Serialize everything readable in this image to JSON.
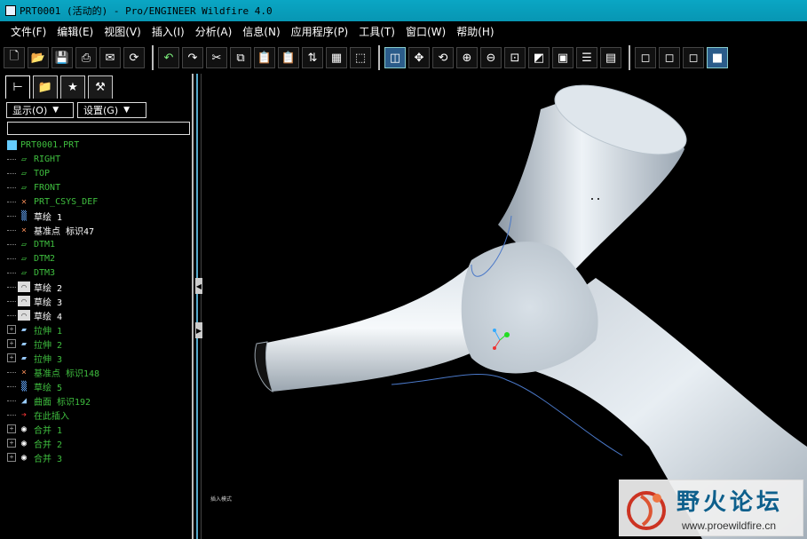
{
  "window": {
    "title": "PRT0001 (活动的) - Pro/ENGINEER Wildfire 4.0"
  },
  "menu": [
    "文件(F)",
    "编辑(E)",
    "视图(V)",
    "插入(I)",
    "分析(A)",
    "信息(N)",
    "应用程序(P)",
    "工具(T)",
    "窗口(W)",
    "帮助(H)"
  ],
  "panel": {
    "show_label": "显示(O)",
    "settings_label": "设置(G)",
    "tree": [
      {
        "label": "PRT0001.PRT",
        "kind": "root"
      },
      {
        "label": "RIGHT",
        "kind": "plane"
      },
      {
        "label": "TOP",
        "kind": "plane"
      },
      {
        "label": "FRONT",
        "kind": "plane"
      },
      {
        "label": "PRT_CSYS_DEF",
        "kind": "csys"
      },
      {
        "label": "草绘 1",
        "kind": "sketch"
      },
      {
        "label": "基准点 标识47",
        "kind": "point"
      },
      {
        "label": "DTM1",
        "kind": "plane"
      },
      {
        "label": "DTM2",
        "kind": "plane"
      },
      {
        "label": "DTM3",
        "kind": "plane"
      },
      {
        "label": "草绘 2",
        "kind": "sketch-white"
      },
      {
        "label": "草绘 3",
        "kind": "sketch-white"
      },
      {
        "label": "草绘 4",
        "kind": "sketch-white"
      },
      {
        "label": "拉伸 1",
        "kind": "extrude"
      },
      {
        "label": "拉伸 2",
        "kind": "extrude"
      },
      {
        "label": "拉伸 3",
        "kind": "extrude"
      },
      {
        "label": "基准点 标识148",
        "kind": "point"
      },
      {
        "label": "草绘 5",
        "kind": "sketch"
      },
      {
        "label": "曲面 标识192",
        "kind": "surface"
      },
      {
        "label": "在此插入",
        "kind": "insert"
      },
      {
        "label": "合并 1",
        "kind": "merge"
      },
      {
        "label": "合并 2",
        "kind": "merge"
      },
      {
        "label": "合并 3",
        "kind": "merge"
      }
    ]
  },
  "graphics": {
    "corner_text": "插入模式"
  },
  "watermark": {
    "title": "野火论坛",
    "url": "www.proewildfire.cn"
  },
  "colors": {
    "tree_text": "#3fbf3f",
    "surface": "#c9d3dc",
    "edge": "#4a78c8"
  }
}
